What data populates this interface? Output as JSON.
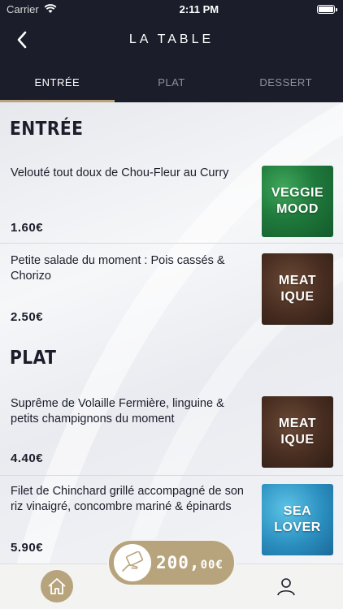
{
  "status": {
    "carrier": "Carrier",
    "time": "2:11 PM"
  },
  "nav": {
    "title": "LA TABLE"
  },
  "tabs": [
    {
      "label": "ENTRÉE",
      "active": true
    },
    {
      "label": "PLAT",
      "active": false
    },
    {
      "label": "DESSERT",
      "active": false
    }
  ],
  "sections": {
    "entree": {
      "title": "ENTRÉE",
      "items": [
        {
          "name": "Velouté tout doux de Chou-Fleur au Curry",
          "price": "1.60€",
          "badge": "VEGGIE\nMOOD",
          "badge_type": "veggie"
        },
        {
          "name": "Petite salade du moment : Pois cassés & Chorizo",
          "price": "2.50€",
          "badge": "MEAT\nIQUE",
          "badge_type": "meat"
        }
      ]
    },
    "plat": {
      "title": "PLAT",
      "items": [
        {
          "name": "Suprême de Volaille Fermière, linguine & petits champignons du moment",
          "price": "4.40€",
          "badge": "MEAT\nIQUE",
          "badge_type": "meat"
        },
        {
          "name": "Filet de Chinchard grillé accompagné de son riz vinaigré, concombre mariné & épinards",
          "price": "5.90€",
          "badge": "SEA\nLOVER",
          "badge_type": "sea"
        }
      ]
    }
  },
  "wallet": {
    "amount_main": "200,",
    "amount_dec": "00€"
  },
  "colors": {
    "header_bg": "#1b1d2a",
    "accent_gold": "#b7a47c"
  },
  "icons": {
    "back": "chevron-left-icon",
    "home": "home-icon",
    "profile": "user-icon",
    "wallet": "card-hand-icon"
  }
}
